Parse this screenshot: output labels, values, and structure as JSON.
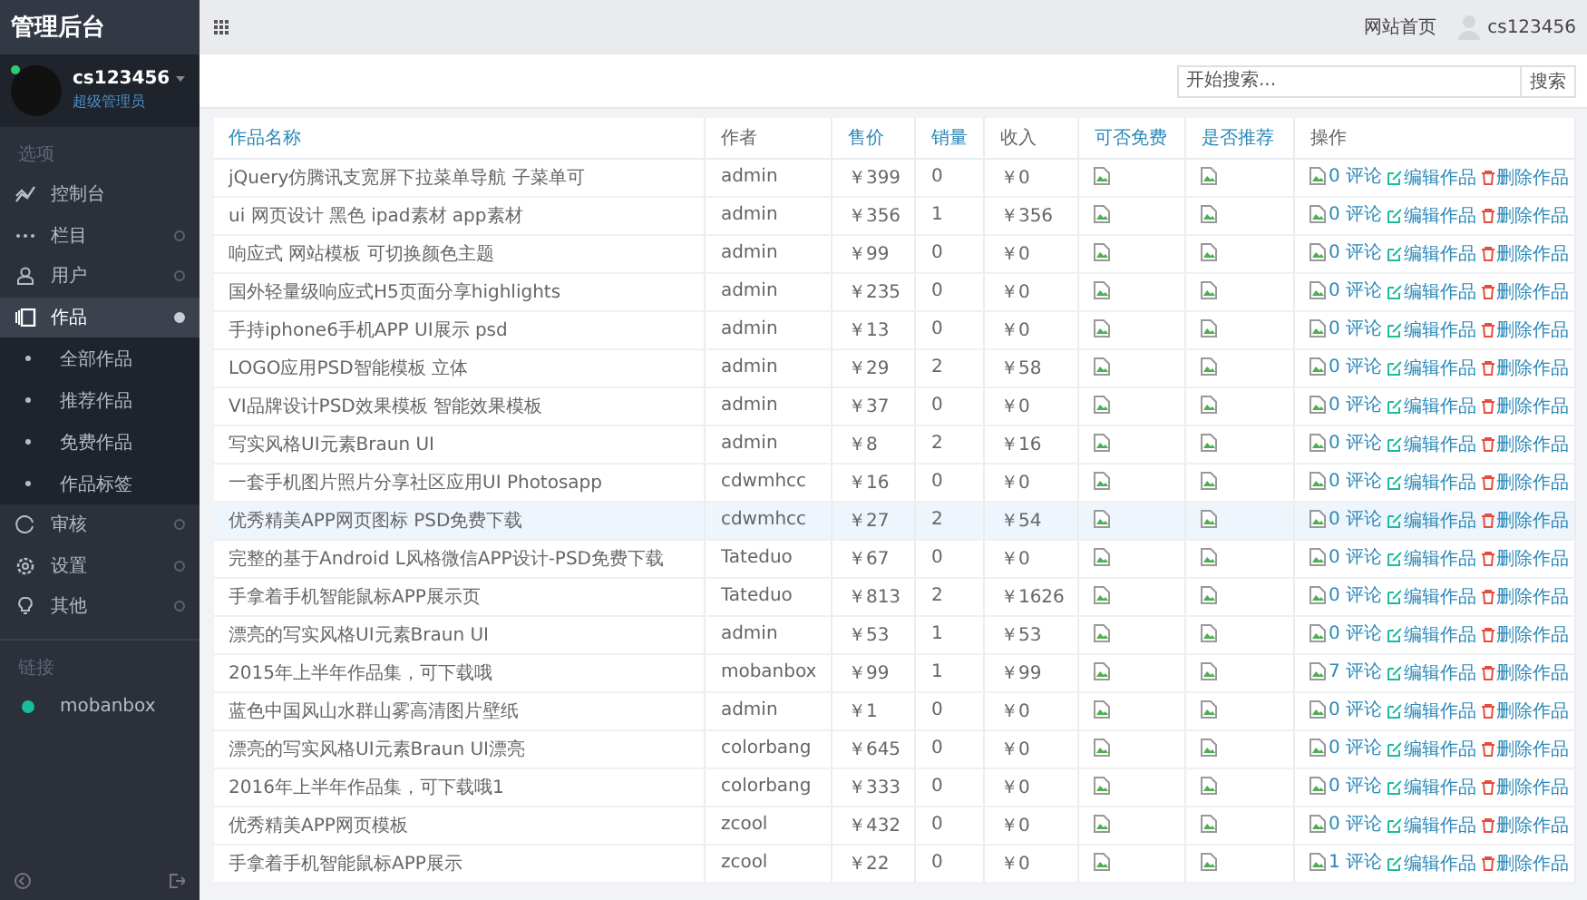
{
  "sidebar": {
    "title": "管理后台",
    "user": {
      "name": "cs123456",
      "role": "超级管理员",
      "online": true
    },
    "sections": [
      {
        "label": "选项",
        "items": [
          {
            "label": "控制台",
            "selected": false
          },
          {
            "label": "栏目",
            "selected": false,
            "expanded": false
          },
          {
            "label": "用户",
            "selected": false,
            "expanded": false
          },
          {
            "label": "作品",
            "selected": true,
            "expanded": true,
            "children": [
              {
                "label": "全部作品"
              },
              {
                "label": "推荐作品"
              },
              {
                "label": "免费作品"
              },
              {
                "label": "作品标签"
              }
            ]
          },
          {
            "label": "审核",
            "selected": false,
            "expanded": false
          },
          {
            "label": "设置",
            "selected": false,
            "expanded": false
          },
          {
            "label": "其他",
            "selected": false,
            "expanded": false
          }
        ]
      },
      {
        "label": "链接",
        "links": [
          {
            "label": "mobanbox",
            "color": "#1abc9c"
          }
        ]
      }
    ]
  },
  "topbar": {
    "home_link": "网站首页",
    "user": "cs123456"
  },
  "search": {
    "placeholder": "开始搜索...",
    "button": "搜索"
  },
  "table": {
    "columns": [
      "作品名称",
      "作者",
      "售价",
      "销量",
      "收入",
      "可否免费",
      "是否推荐",
      "操作"
    ],
    "rows": [
      {
        "name": "jQuery仿腾讯支宽屏下拉菜单导航 子菜单可",
        "author": "admin",
        "price": "￥399",
        "sales": "0",
        "income": "￥0",
        "comments": "0 评论",
        "edit": "编辑作品",
        "delete": "删除作品",
        "highlighted": false
      },
      {
        "name": "ui 网页设计 黑色 ipad素材 app素材",
        "author": "admin",
        "price": "￥356",
        "sales": "1",
        "income": "￥356",
        "comments": "0 评论",
        "edit": "编辑作品",
        "delete": "删除作品",
        "highlighted": false
      },
      {
        "name": "响应式 网站模板 可切换颜色主题",
        "author": "admin",
        "price": "￥99",
        "sales": "0",
        "income": "￥0",
        "comments": "0 评论",
        "edit": "编辑作品",
        "delete": "删除作品",
        "highlighted": false
      },
      {
        "name": "国外轻量级响应式H5页面分享highlights",
        "author": "admin",
        "price": "￥235",
        "sales": "0",
        "income": "￥0",
        "comments": "0 评论",
        "edit": "编辑作品",
        "delete": "删除作品",
        "highlighted": false
      },
      {
        "name": "手持iphone6手机APP UI展示 psd",
        "author": "admin",
        "price": "￥13",
        "sales": "0",
        "income": "￥0",
        "comments": "0 评论",
        "edit": "编辑作品",
        "delete": "删除作品",
        "highlighted": false
      },
      {
        "name": "LOGO应用PSD智能模板 立体",
        "author": "admin",
        "price": "￥29",
        "sales": "2",
        "income": "￥58",
        "comments": "0 评论",
        "edit": "编辑作品",
        "delete": "删除作品",
        "highlighted": false
      },
      {
        "name": "VI品牌设计PSD效果模板 智能效果模板",
        "author": "admin",
        "price": "￥37",
        "sales": "0",
        "income": "￥0",
        "comments": "0 评论",
        "edit": "编辑作品",
        "delete": "删除作品",
        "highlighted": false
      },
      {
        "name": "写实风格UI元素Braun UI",
        "author": "admin",
        "price": "￥8",
        "sales": "2",
        "income": "￥16",
        "comments": "0 评论",
        "edit": "编辑作品",
        "delete": "删除作品",
        "highlighted": false
      },
      {
        "name": "一套手机图片照片分享社区应用UI Photosapp",
        "author": "cdwmhcc",
        "price": "￥16",
        "sales": "0",
        "income": "￥0",
        "comments": "0 评论",
        "edit": "编辑作品",
        "delete": "删除作品",
        "highlighted": false
      },
      {
        "name": "优秀精美APP网页图标 PSD免费下载",
        "author": "cdwmhcc",
        "price": "￥27",
        "sales": "2",
        "income": "￥54",
        "comments": "0 评论",
        "edit": "编辑作品",
        "delete": "删除作品",
        "highlighted": true
      },
      {
        "name": "完整的基于Android L风格微信APP设计-PSD免费下载",
        "author": "Tateduo",
        "price": "￥67",
        "sales": "0",
        "income": "￥0",
        "comments": "0 评论",
        "edit": "编辑作品",
        "delete": "删除作品",
        "highlighted": false
      },
      {
        "name": "手拿着手机智能鼠标APP展示页",
        "author": "Tateduo",
        "price": "￥813",
        "sales": "2",
        "income": "￥1626",
        "comments": "0 评论",
        "edit": "编辑作品",
        "delete": "删除作品",
        "highlighted": false
      },
      {
        "name": "漂亮的写实风格UI元素Braun UI",
        "author": "admin",
        "price": "￥53",
        "sales": "1",
        "income": "￥53",
        "comments": "0 评论",
        "edit": "编辑作品",
        "delete": "删除作品",
        "highlighted": false
      },
      {
        "name": "2015年上半年作品集，可下载哦",
        "author": "mobanbox",
        "price": "￥99",
        "sales": "1",
        "income": "￥99",
        "comments": "7 评论",
        "edit": "编辑作品",
        "delete": "删除作品",
        "highlighted": false
      },
      {
        "name": "蓝色中国风山水群山雾高清图片壁纸",
        "author": "admin",
        "price": "￥1",
        "sales": "0",
        "income": "￥0",
        "comments": "0 评论",
        "edit": "编辑作品",
        "delete": "删除作品",
        "highlighted": false
      },
      {
        "name": "漂亮的写实风格UI元素Braun UI漂亮",
        "author": "colorbang",
        "price": "￥645",
        "sales": "0",
        "income": "￥0",
        "comments": "0 评论",
        "edit": "编辑作品",
        "delete": "删除作品",
        "highlighted": false
      },
      {
        "name": "2016年上半年作品集，可下载哦1",
        "author": "colorbang",
        "price": "￥333",
        "sales": "0",
        "income": "￥0",
        "comments": "0 评论",
        "edit": "编辑作品",
        "delete": "删除作品",
        "highlighted": false
      },
      {
        "name": "优秀精美APP网页模板",
        "author": "zcool",
        "price": "￥432",
        "sales": "0",
        "income": "￥0",
        "comments": "0 评论",
        "edit": "编辑作品",
        "delete": "删除作品",
        "highlighted": false
      },
      {
        "name": "手拿着手机智能鼠标APP展示",
        "author": "zcool",
        "price": "￥22",
        "sales": "0",
        "income": "￥0",
        "comments": "1 评论",
        "edit": "编辑作品",
        "delete": "删除作品",
        "highlighted": false
      }
    ]
  }
}
